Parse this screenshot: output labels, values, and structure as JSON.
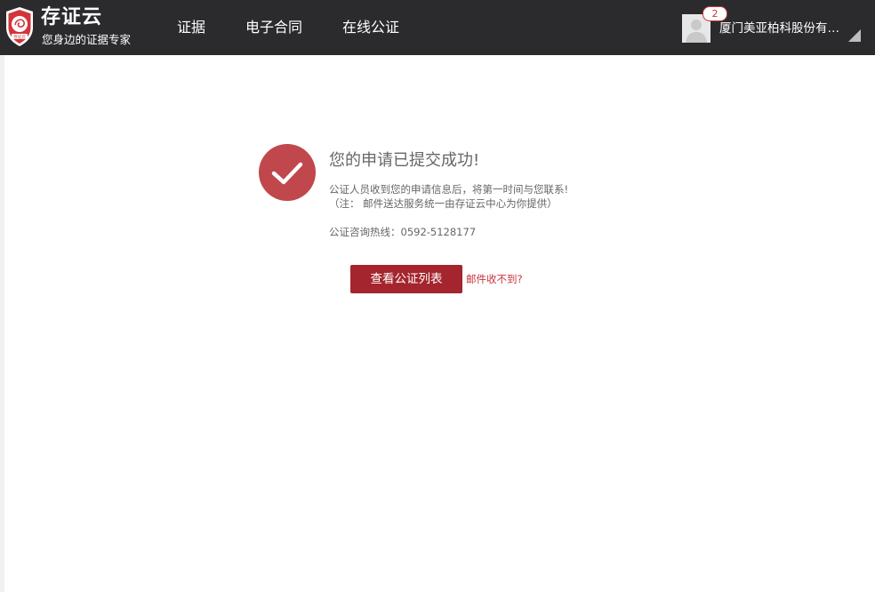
{
  "header": {
    "brand_title": "存证云",
    "brand_subtitle": "您身边的证据专家",
    "logo_text": "存证云",
    "nav": [
      {
        "label": "证据"
      },
      {
        "label": "电子合同"
      },
      {
        "label": "在线公证"
      }
    ],
    "notification_count": "2",
    "company_name": "厦门美亚柏科股份有限公司",
    "icons": {
      "logo": "shield-logo-icon",
      "avatar": "user-avatar-icon",
      "caret": "dropdown-caret-icon"
    }
  },
  "main": {
    "success_title": "您的申请已提交成功!",
    "message_line1": "公证人员收到您的申请信息后，将第一时间与您联系!",
    "message_line2": "（注：  邮件送达服务统一由存证云中心为你提供）",
    "hotline": "公证咨询热线：0592-5128177",
    "view_list_button": "查看公证列表",
    "mail_not_received_link": "邮件收不到?",
    "icons": {
      "success": "checkmark-icon"
    }
  },
  "colors": {
    "header_bg": "#2b2b2e",
    "brand_red": "#a4252d",
    "success_circle": "#c0474c",
    "link_red": "#c8343a",
    "text_gray": "#666666"
  }
}
